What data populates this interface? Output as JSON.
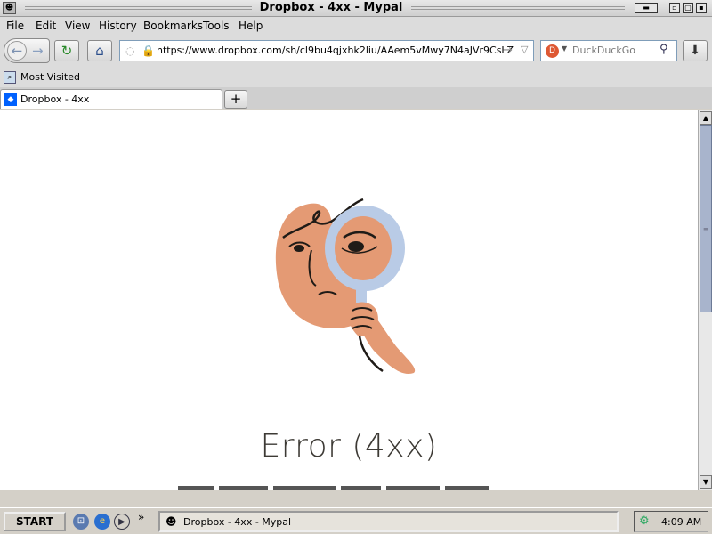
{
  "window": {
    "title": "Dropbox - 4xx - Mypal"
  },
  "menu": [
    "File",
    "Edit",
    "View",
    "History",
    "Bookmarks",
    "Tools",
    "Help"
  ],
  "navigation": {
    "url": "https://www.dropbox.com/sh/cl9bu4qjxhk2liu/AAem5vMwy7N4aJVr9CsLZ",
    "search_engine": "DuckDuckGo",
    "search_placeholder": "DuckDuckGo"
  },
  "bookmarks": {
    "items": [
      "Most Visited"
    ]
  },
  "tabs": [
    {
      "label": "Dropbox - 4xx",
      "active": true
    }
  ],
  "content": {
    "error_title": "Error (4xx)",
    "illustration": "person-with-magnifying-glass"
  },
  "taskbar": {
    "start_label": "START",
    "tasks": [
      "Dropbox - 4xx - Mypal"
    ],
    "clock": "4:09 AM"
  },
  "colors": {
    "skin": "#e49a74",
    "lens": "#b9cbe6",
    "lens_inner": "#e49a74",
    "ink": "#1f1b17",
    "error_text": "#3d3a35",
    "scroll_thumb": "#a8b4cc",
    "dropbox_blue": "#0061fe"
  }
}
